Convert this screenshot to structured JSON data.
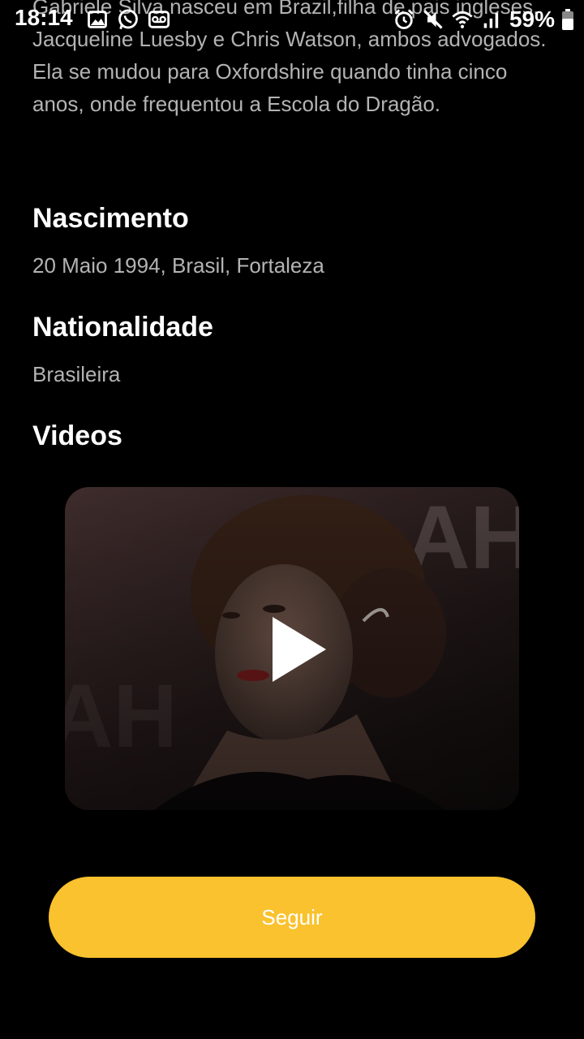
{
  "status_bar": {
    "time": "18:14",
    "battery": "59%"
  },
  "profile": {
    "bio": "Gabriele Silva nasceu em Brazil,filha de pais ingleses, Jacqueline Luesby e Chris Watson, ambos advogados. Ela se mudou para Oxfordshire quando tinha cinco anos, onde frequentou a Escola do Dragão.",
    "birth_label": "Nascimento",
    "birth_value": "20 Maio 1994, Brasil, Fortaleza",
    "nationality_label": "Nationalidade",
    "nationality_value": "Brasileira",
    "videos_label": "Videos"
  },
  "actions": {
    "follow_label": "Seguir"
  },
  "colors": {
    "background": "#000000",
    "accent": "#f9c22e",
    "muted_text": "#b3b3b3"
  },
  "icons": [
    "gallery-icon",
    "whatsapp-icon",
    "voicemail-icon",
    "alarm-icon",
    "mute-icon",
    "wifi-icon",
    "signal-icon",
    "battery-icon",
    "play-icon"
  ]
}
